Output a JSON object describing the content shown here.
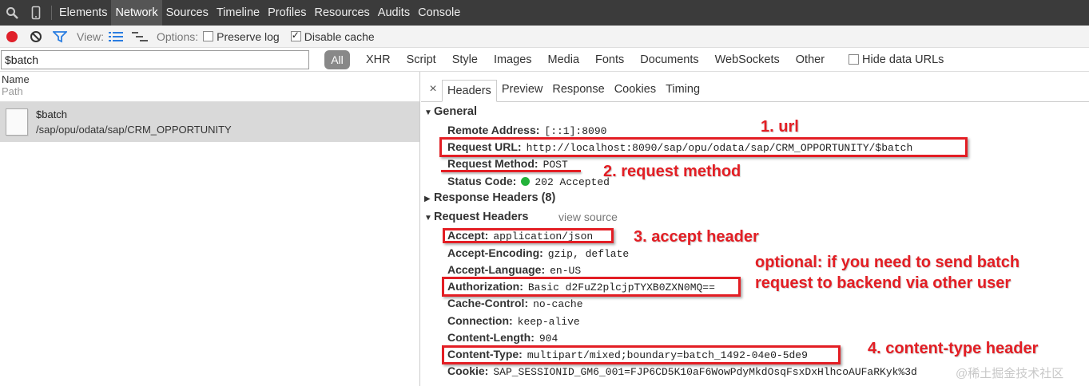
{
  "toptabs": [
    "Elements",
    "Network",
    "Sources",
    "Timeline",
    "Profiles",
    "Resources",
    "Audits",
    "Console"
  ],
  "toolbar": {
    "view_label": "View:",
    "options_label": "Options:",
    "preserve_log": "Preserve log",
    "disable_cache": "Disable cache"
  },
  "filter": {
    "value": "$batch",
    "all": "All",
    "types": [
      "XHR",
      "Script",
      "Style",
      "Images",
      "Media",
      "Fonts",
      "Documents",
      "WebSockets",
      "Other"
    ],
    "hide_data_urls": "Hide data URLs"
  },
  "list": {
    "col_name": "Name",
    "col_path": "Path",
    "request_name": "$batch",
    "request_path": "/sap/opu/odata/sap/CRM_OPPORTUNITY"
  },
  "detail": {
    "tabs": [
      "Headers",
      "Preview",
      "Response",
      "Cookies",
      "Timing"
    ],
    "close": "×",
    "general": "General",
    "general_items": [
      {
        "k": "Remote Address:",
        "v": "[::1]:8090"
      },
      {
        "k": "Request URL:",
        "v": "http://localhost:8090/sap/opu/odata/sap/CRM_OPPORTUNITY/$batch"
      },
      {
        "k": "Request Method:",
        "v": "POST"
      },
      {
        "k": "Status Code:",
        "v": "202 Accepted"
      }
    ],
    "response_headers": "Response Headers (8)",
    "request_headers": "Request Headers",
    "view_source": "view source",
    "request_items": [
      {
        "k": "Accept:",
        "v": "application/json"
      },
      {
        "k": "Accept-Encoding:",
        "v": "gzip, deflate"
      },
      {
        "k": "Accept-Language:",
        "v": "en-US"
      },
      {
        "k": "Authorization:",
        "v": "Basic d2FuZ2plcjpTYXB0ZXN0MQ=="
      },
      {
        "k": "Cache-Control:",
        "v": "no-cache"
      },
      {
        "k": "Connection:",
        "v": "keep-alive"
      },
      {
        "k": "Content-Length:",
        "v": "904"
      },
      {
        "k": "Content-Type:",
        "v": "multipart/mixed;boundary=batch_1492-04e0-5de9"
      },
      {
        "k": "Cookie:",
        "v": "SAP_SESSIONID_GM6_001=FJP6CD5K10aF6WowPdyMkdOsqFsxDxHlhcoAUFaRKyk%3d"
      }
    ]
  },
  "annotations": {
    "url": "1. url",
    "method": "2. request method",
    "accept": "3. accept header",
    "optional_1": "optional: if you need to send batch",
    "optional_2": "request to backend via other user",
    "content_type": "4. content-type header"
  },
  "watermark": "@稀土掘金技术社区",
  "colors": {
    "annotation": "#e31e24",
    "status_ok": "#23b23a",
    "record": "#e0202a"
  }
}
